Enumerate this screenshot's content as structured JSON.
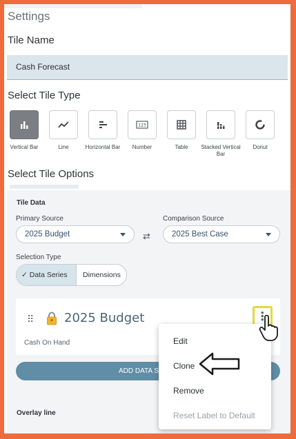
{
  "settings": {
    "title": "Settings"
  },
  "tile_name": {
    "heading": "Tile Name",
    "value": "Cash Forecast"
  },
  "tile_type": {
    "heading": "Select Tile Type",
    "types": [
      {
        "label": "Vertical Bar",
        "icon": "vertical-bar-icon",
        "selected": true
      },
      {
        "label": "Line",
        "icon": "line-chart-icon",
        "selected": false
      },
      {
        "label": "Horizontal Bar",
        "icon": "horizontal-bar-icon",
        "selected": false
      },
      {
        "label": "Number",
        "icon": "number-icon",
        "selected": false
      },
      {
        "label": "Table",
        "icon": "table-icon",
        "selected": false
      },
      {
        "label": "Stacked Vertical Bar",
        "icon": "stacked-bar-icon",
        "selected": false
      },
      {
        "label": "Donut",
        "icon": "donut-icon",
        "selected": false
      }
    ]
  },
  "tile_options": {
    "heading": "Select Tile Options",
    "tile_data_heading": "Tile Data",
    "primary_source": {
      "label": "Primary Source",
      "value": "2025 Budget"
    },
    "comparison_source": {
      "label": "Comparison Source",
      "value": "2025 Best Case"
    },
    "swap_icon": "swap-arrows-icon",
    "selection_type": {
      "label": "Selection Type",
      "options": [
        "Data Series",
        "Dimensions"
      ],
      "selected": "Data Series"
    },
    "series_card": {
      "title": "2025 Budget",
      "subtitle": "Cash On Hand",
      "lock_icon": "lock-icon"
    },
    "add_button_label": "ADD DATA S",
    "overlay_heading": "Overlay line"
  },
  "context_menu": {
    "items": [
      {
        "label": "Edit",
        "disabled": false
      },
      {
        "label": "Clone",
        "disabled": false
      },
      {
        "label": "Remove",
        "disabled": false
      },
      {
        "label": "Reset Label to Default",
        "disabled": true
      }
    ]
  },
  "colors": {
    "border": "#ef6a3c",
    "selected_tile": "#7b7f84",
    "primary_button": "#5f8ea6",
    "highlight": "#e1db3a",
    "accent_text": "#4c6476"
  }
}
